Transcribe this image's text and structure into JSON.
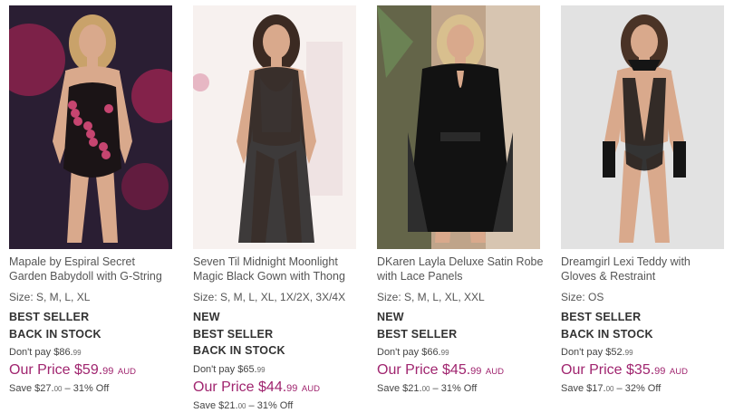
{
  "products": [
    {
      "title": "Mapale by Espiral Secret Garden Babydoll with G-String",
      "size": "Size: S, M, L, XL",
      "flags": [
        "BEST SELLER",
        "BACK IN STOCK"
      ],
      "dont_pay_label": "Don't pay",
      "dont_pay_dollars": "$86.",
      "dont_pay_cents": "99",
      "our_price_label": "Our Price",
      "our_price_dollars": "$59.",
      "our_price_cents": "99",
      "currency": "AUD",
      "save_label": "Save",
      "save_dollars": "$27.",
      "save_cents": "00",
      "save_pct": "– 31% Off",
      "image_colors": {
        "bg": "#2a1e33",
        "accent": "#c0245a",
        "garment": "#1b1416",
        "print": "#d94a7a"
      }
    },
    {
      "title": "Seven Til Midnight Moonlight Magic Black Gown with Thong",
      "size": "Size: S, M, L, XL, 1X/2X, 3X/4X",
      "flags": [
        "NEW",
        "BEST SELLER",
        "BACK IN STOCK"
      ],
      "dont_pay_label": "Don't pay",
      "dont_pay_dollars": "$65.",
      "dont_pay_cents": "99",
      "our_price_label": "Our Price",
      "our_price_dollars": "$44.",
      "our_price_cents": "99",
      "currency": "AUD",
      "save_label": "Save",
      "save_dollars": "$21.",
      "save_cents": "00",
      "save_pct": "– 31% Off",
      "image_colors": {
        "bg": "#f4eeec",
        "accent": "#e7b7c4",
        "garment": "#1c1a1a",
        "print": "#3a3535"
      }
    },
    {
      "title": "DKaren Layla Deluxe Satin Robe with Lace Panels",
      "size": "Size: S, M, L, XL, XXL",
      "flags": [
        "NEW",
        "BEST SELLER"
      ],
      "dont_pay_label": "Don't pay",
      "dont_pay_dollars": "$66.",
      "dont_pay_cents": "99",
      "our_price_label": "Our Price",
      "our_price_dollars": "$45.",
      "our_price_cents": "99",
      "currency": "AUD",
      "save_label": "Save",
      "save_dollars": "$21.",
      "save_cents": "00",
      "save_pct": "– 31% Off",
      "image_colors": {
        "bg": "#bfa48a",
        "accent": "#6d8a57",
        "garment": "#121212",
        "print": "#2e2e2e"
      }
    },
    {
      "title": "Dreamgirl Lexi Teddy with Gloves & Restraint",
      "size": "Size: OS",
      "flags": [
        "BEST SELLER",
        "BACK IN STOCK"
      ],
      "dont_pay_label": "Don't pay",
      "dont_pay_dollars": "$52.",
      "dont_pay_cents": "99",
      "our_price_label": "Our Price",
      "our_price_dollars": "$35.",
      "our_price_cents": "99",
      "currency": "AUD",
      "save_label": "Save",
      "save_dollars": "$17.",
      "save_cents": "00",
      "save_pct": "– 32% Off",
      "image_colors": {
        "bg": "#d9d9d9",
        "accent": "#bcbcbc",
        "garment": "#151515",
        "print": "#333333"
      }
    }
  ],
  "theme": {
    "price_color": "#a0256f",
    "text_color": "#555555",
    "flag_color": "#333333"
  }
}
